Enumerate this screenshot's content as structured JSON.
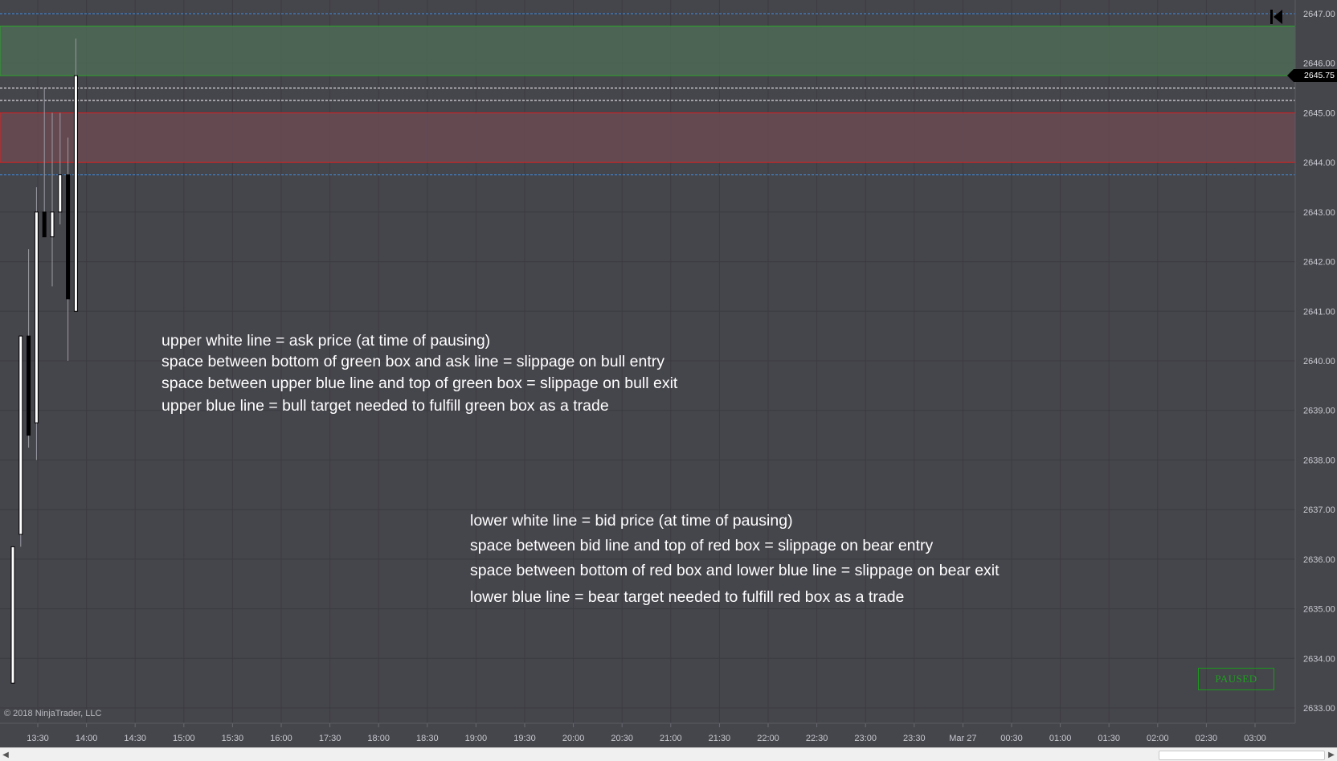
{
  "chart_data": {
    "type": "candlestick",
    "y_axis": {
      "ticks": [
        "2647.00",
        "2646.00",
        "2645.00",
        "2644.00",
        "2643.00",
        "2642.00",
        "2641.00",
        "2640.00",
        "2639.00",
        "2638.00",
        "2637.00",
        "2636.00",
        "2635.00",
        "2634.00",
        "2633.00"
      ],
      "range": [
        2632.75,
        2647.25
      ]
    },
    "x_axis": {
      "ticks": [
        "13:30",
        "14:00",
        "14:30",
        "15:00",
        "15:30",
        "16:00",
        "17:30",
        "18:00",
        "18:30",
        "19:00",
        "19:30",
        "20:00",
        "20:30",
        "21:00",
        "21:30",
        "22:00",
        "22:30",
        "23:00",
        "23:30",
        "Mar 27",
        "00:30",
        "01:00",
        "01:30",
        "02:00",
        "02:30",
        "03:00"
      ]
    },
    "candles": [
      {
        "open": 2633.5,
        "close": 2636.25,
        "high": 2636.25,
        "low": 2633.5,
        "bull": true
      },
      {
        "open": 2636.5,
        "close": 2640.5,
        "high": 2639.75,
        "low": 2636.25,
        "bull": true
      },
      {
        "open": 2640.5,
        "close": 2638.5,
        "high": 2642.25,
        "low": 2638.25,
        "bull": false
      },
      {
        "open": 2638.75,
        "close": 2643.0,
        "high": 2643.5,
        "low": 2638.0,
        "bull": true
      },
      {
        "open": 2643.0,
        "close": 2642.5,
        "high": 2645.5,
        "low": 2642.5,
        "bull": false
      },
      {
        "open": 2642.5,
        "close": 2643.0,
        "high": 2645.0,
        "low": 2641.5,
        "bull": true
      },
      {
        "open": 2643.0,
        "close": 2643.75,
        "high": 2645.0,
        "low": 2642.75,
        "bull": true
      },
      {
        "open": 2643.75,
        "close": 2641.25,
        "high": 2644.5,
        "low": 2640.0,
        "bull": false
      },
      {
        "open": 2641.0,
        "close": 2645.75,
        "high": 2646.5,
        "low": 2641.0,
        "bull": true
      }
    ],
    "last_price": "2645.75",
    "zones": {
      "green_box": {
        "top": 2646.75,
        "bottom": 2645.75,
        "color": "#4f6b55"
      },
      "red_box": {
        "top": 2645.0,
        "bottom": 2644.0,
        "color": "#6b4a52"
      }
    },
    "lines": {
      "upper_blue": 2647.0,
      "ask_white": 2645.5,
      "bid_white": 2645.25,
      "lower_blue": 2643.75
    }
  },
  "annotations_upper": [
    "upper white line = ask price (at time of pausing)",
    "space between bottom of green box and ask line  = slippage on bull entry",
    "space between upper blue line and top of green box = slippage on bull exit",
    "upper blue line = bull target needed to fulfill green box as a trade"
  ],
  "annotations_lower": [
    "lower white line = bid price (at time of pausing)",
    "space between bid line and top of red box = slippage on bear entry",
    "space between bottom of red box and lower blue line  = slippage on bear exit",
    "lower blue line = bear target needed to fulfill red box as a trade"
  ],
  "copyright": "© 2018 NinjaTrader, LLC",
  "paused_label": "PAUSED",
  "icons": {
    "skip": "skip-to-start-icon"
  },
  "colors": {
    "background": "#45454c",
    "grid": "#3a3a40",
    "axis_text": "#c8c8d0",
    "blue_line": "#3f8fe0",
    "white_line": "#ffffff"
  }
}
